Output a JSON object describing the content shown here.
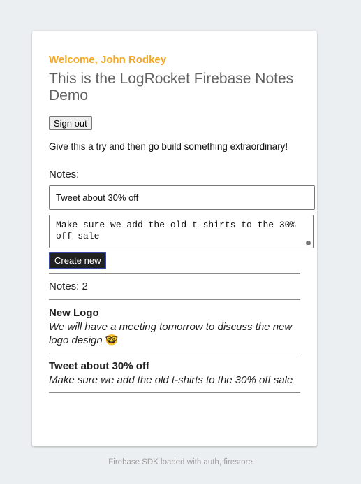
{
  "header": {
    "welcome": "Welcome, John Rodkey",
    "headline": "This is the LogRocket Firebase Notes Demo",
    "sign_out_label": "Sign out",
    "tagline": "Give this a try and then go build something extraordinary!"
  },
  "form": {
    "notes_label": "Notes:",
    "title_value": "Tweet about 30% off",
    "body_value": "Make sure we add the old t-shirts to the 30% off sale",
    "create_label": "Create new"
  },
  "notes": {
    "count_label": "Notes: 2",
    "items": [
      {
        "title": "New Logo",
        "body": "We will have a meeting tomorrow to discuss the new logo design",
        "emoji": "🤓"
      },
      {
        "title": "Tweet about 30% off",
        "body": "Make sure we add the old t-shirts to the 30% off sale"
      }
    ]
  },
  "footer": {
    "status": "Firebase SDK loaded with auth, firestore"
  },
  "colors": {
    "page_bg": "#eceff1",
    "welcome_accent": "#f5a623",
    "create_button_bg": "#212121",
    "create_button_border": "#3949ab"
  }
}
